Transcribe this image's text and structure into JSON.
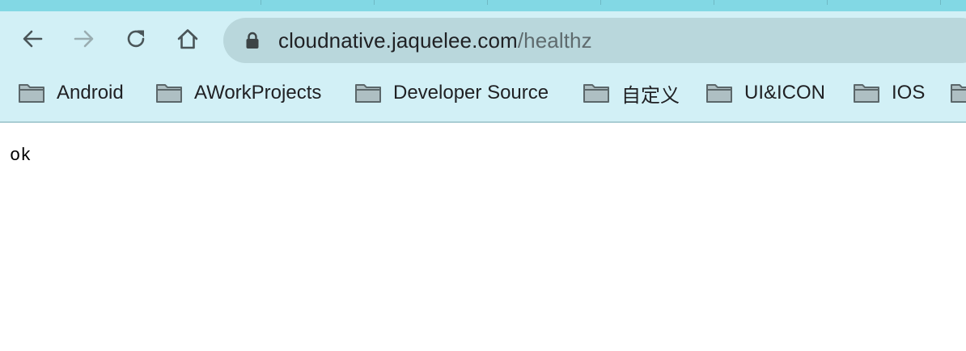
{
  "browser": {
    "theme_color": "#d2f0f6",
    "tab_strip_color": "#82d8e4",
    "toolbar": {
      "back_icon": "arrow-left-icon",
      "forward_icon": "arrow-right-icon",
      "reload_icon": "reload-icon",
      "home_icon": "home-icon"
    },
    "omnibox": {
      "security_icon": "lock-icon",
      "url_host": "cloudnative.jaquelee.com",
      "url_path": "/healthz"
    },
    "bookmarks": [
      {
        "label": "Android",
        "icon": "folder-icon"
      },
      {
        "label": "AWorkProjects",
        "icon": "folder-icon"
      },
      {
        "label": "Developer Source",
        "icon": "folder-icon"
      },
      {
        "label": "自定义",
        "icon": "folder-icon"
      },
      {
        "label": "UI&ICON",
        "icon": "folder-icon"
      },
      {
        "label": "IOS",
        "icon": "folder-icon"
      },
      {
        "label": "",
        "icon": "folder-icon"
      }
    ]
  },
  "page": {
    "body_text": "ok"
  }
}
